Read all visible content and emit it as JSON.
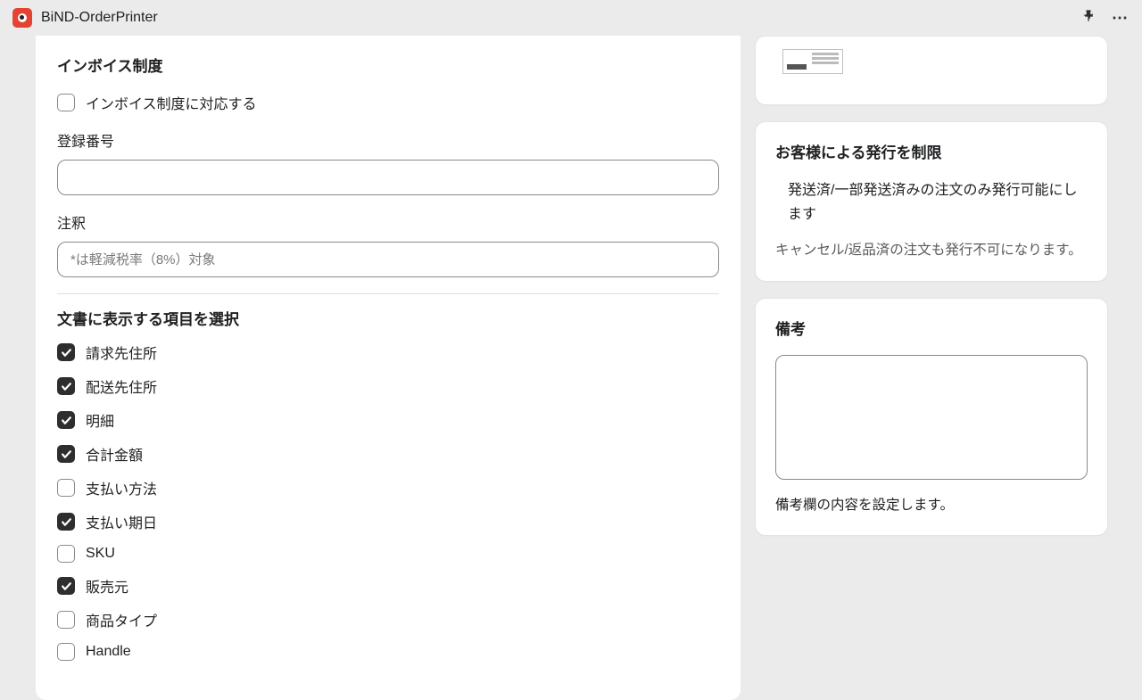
{
  "header": {
    "app_title": "BiND-OrderPrinter"
  },
  "main": {
    "invoice_section_title": "インボイス制度",
    "invoice_checkbox_label": "インボイス制度に対応する",
    "invoice_checkbox_checked": false,
    "reg_number_label": "登録番号",
    "reg_number_value": "",
    "note_label": "注釈",
    "note_placeholder": "*は軽減税率（8%）対象",
    "note_value": "",
    "display_fields_title": "文書に表示する項目を選択",
    "fields": [
      {
        "label": "請求先住所",
        "checked": true
      },
      {
        "label": "配送先住所",
        "checked": true
      },
      {
        "label": "明細",
        "checked": true
      },
      {
        "label": "合計金額",
        "checked": true
      },
      {
        "label": "支払い方法",
        "checked": false
      },
      {
        "label": "支払い期日",
        "checked": true
      },
      {
        "label": "SKU",
        "checked": false
      },
      {
        "label": "販売元",
        "checked": true
      },
      {
        "label": "商品タイプ",
        "checked": false
      },
      {
        "label": "Handle",
        "checked": false
      }
    ]
  },
  "side": {
    "restrict_title": "お客様による発行を制限",
    "restrict_checkbox_label": "発送済/一部発送済みの注文のみ発行可能にします",
    "restrict_checkbox_checked": false,
    "restrict_help": "キャンセル/返品済の注文も発行不可になります。",
    "remarks_title": "備考",
    "remarks_value": "",
    "remarks_help": "備考欄の内容を設定します。"
  }
}
